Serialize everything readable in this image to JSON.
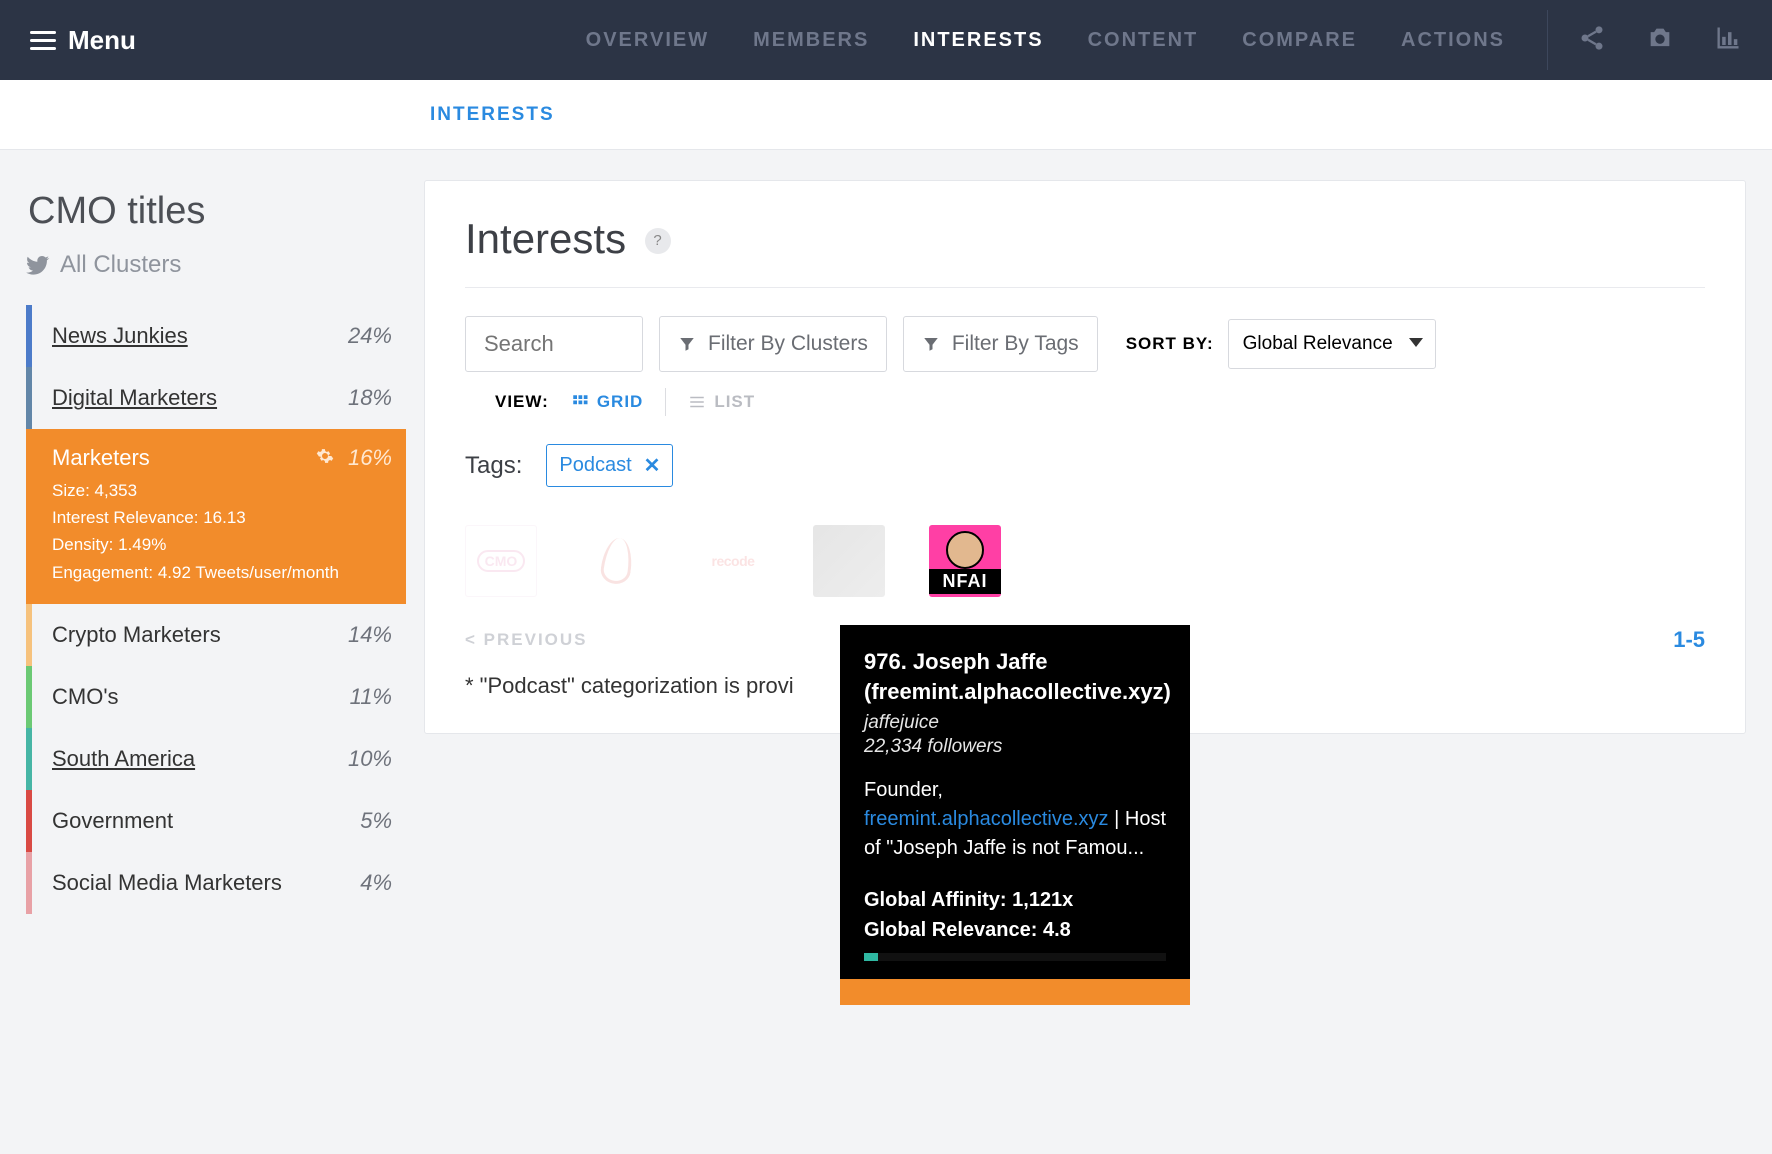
{
  "nav": {
    "menu": "Menu",
    "tabs": [
      "OVERVIEW",
      "MEMBERS",
      "INTERESTS",
      "CONTENT",
      "COMPARE",
      "ACTIONS"
    ],
    "active_tab": "INTERESTS"
  },
  "subnav": {
    "item": "INTERESTS"
  },
  "sidebar": {
    "title": "CMO titles",
    "subtitle": "All Clusters",
    "clusters": [
      {
        "name": "News Junkies",
        "pct": "24%",
        "color": "c-blue"
      },
      {
        "name": "Digital Marketers",
        "pct": "18%",
        "color": "c-steel"
      },
      {
        "name": "Marketers",
        "pct": "16%",
        "color": "c-orange",
        "active": true,
        "stats": {
          "size": "Size: 4,353",
          "rel": "Interest Relevance: 16.13",
          "den": "Density: 1.49%",
          "eng": "Engagement: 4.92 Tweets/user/month"
        }
      },
      {
        "name": "Crypto Marketers",
        "pct": "14%",
        "color": "c-sand"
      },
      {
        "name": "CMO's",
        "pct": "11%",
        "color": "c-green"
      },
      {
        "name": "South America",
        "pct": "10%",
        "color": "c-teal"
      },
      {
        "name": "Government",
        "pct": "5%",
        "color": "c-red"
      },
      {
        "name": "Social Media Marketers",
        "pct": "4%",
        "color": "c-pink"
      }
    ]
  },
  "main": {
    "title": "Interests",
    "search_placeholder": "Search",
    "filter_clusters": "Filter By Clusters",
    "filter_tags": "Filter By Tags",
    "sort_label": "SORT BY:",
    "sort_value": "Global Relevance",
    "view_label": "VIEW:",
    "view_grid": "GRID",
    "view_list": "LIST",
    "tags_label": "Tags:",
    "tag": "Podcast",
    "thumb1": "CMO",
    "thumb3": "recode",
    "thumb5": "NFAI",
    "prev": "< PREVIOUS",
    "range": "1-5",
    "footnote": "* \"Podcast\" categorization is provi"
  },
  "tooltip": {
    "title": "976. Joseph Jaffe (freemint.alphacollective.xyz)",
    "handle": "jaffejuice",
    "followers": "22,334 followers",
    "bio_pre": "Founder, ",
    "bio_link": "freemint.alphacollective.xyz",
    "bio_post": " | Host of \"Joseph Jaffe is not Famou...",
    "affinity": "Global Affinity: 1,121x",
    "relevance": "Global Relevance: 4.8"
  }
}
